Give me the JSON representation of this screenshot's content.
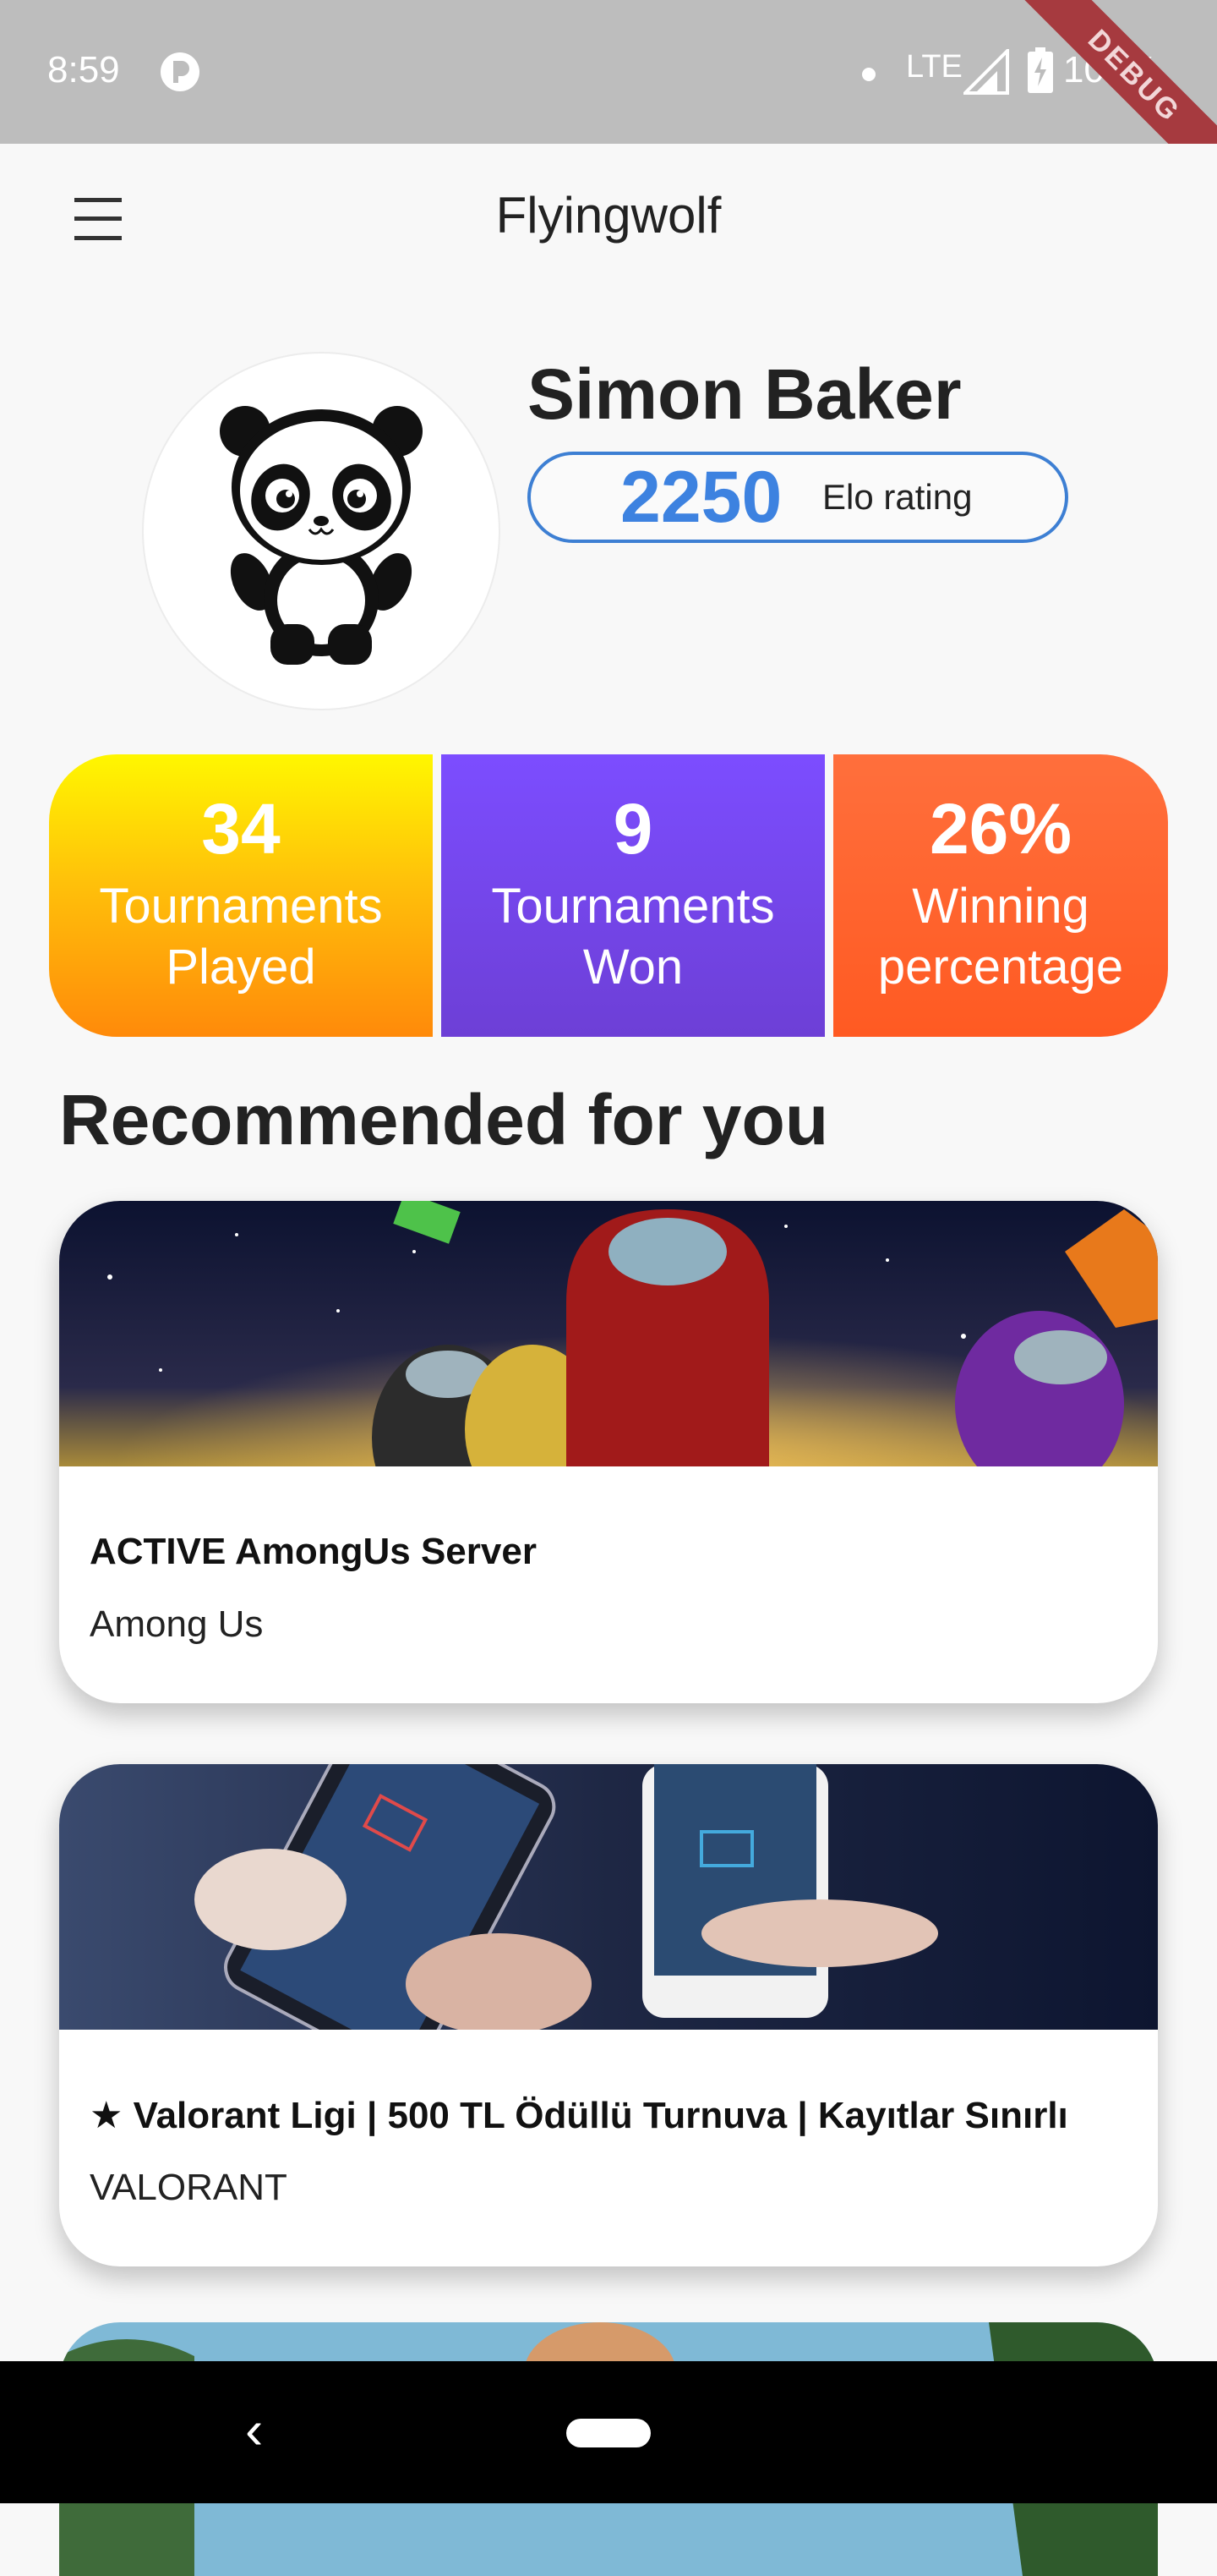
{
  "status_bar": {
    "time": "8:59",
    "network": "LTE",
    "roaming": "R",
    "battery": "100%",
    "debug_label": "DEBUG"
  },
  "app_bar": {
    "title": "Flyingwolf"
  },
  "profile": {
    "name": "Simon Baker",
    "elo_value": "2250",
    "elo_label": "Elo rating",
    "avatar_icon": "panda-avatar"
  },
  "stats": [
    {
      "value": "34",
      "label_line1": "Tournaments",
      "label_line2": "Played"
    },
    {
      "value": "9",
      "label_line1": "Tournaments",
      "label_line2": "Won"
    },
    {
      "value": "26%",
      "label_line1": "Winning",
      "label_line2": "percentage"
    }
  ],
  "section": {
    "title": "Recommended for you"
  },
  "cards": [
    {
      "title": "ACTIVE AmongUs Server",
      "subtitle": "Among Us"
    },
    {
      "title": "★ Valorant Ligi | 500 TL Ödüllü Turnuva | Kayıtlar Sınırlı",
      "subtitle": "VALORANT"
    }
  ],
  "colors": {
    "elo_accent": "#3d82e0",
    "played_gradient": [
      "#fff700",
      "#ff8a0a"
    ],
    "won_gradient": [
      "#7c4dff",
      "#6d3fd6"
    ],
    "pct_gradient": [
      "#ff6f3c",
      "#ff5a22"
    ]
  }
}
